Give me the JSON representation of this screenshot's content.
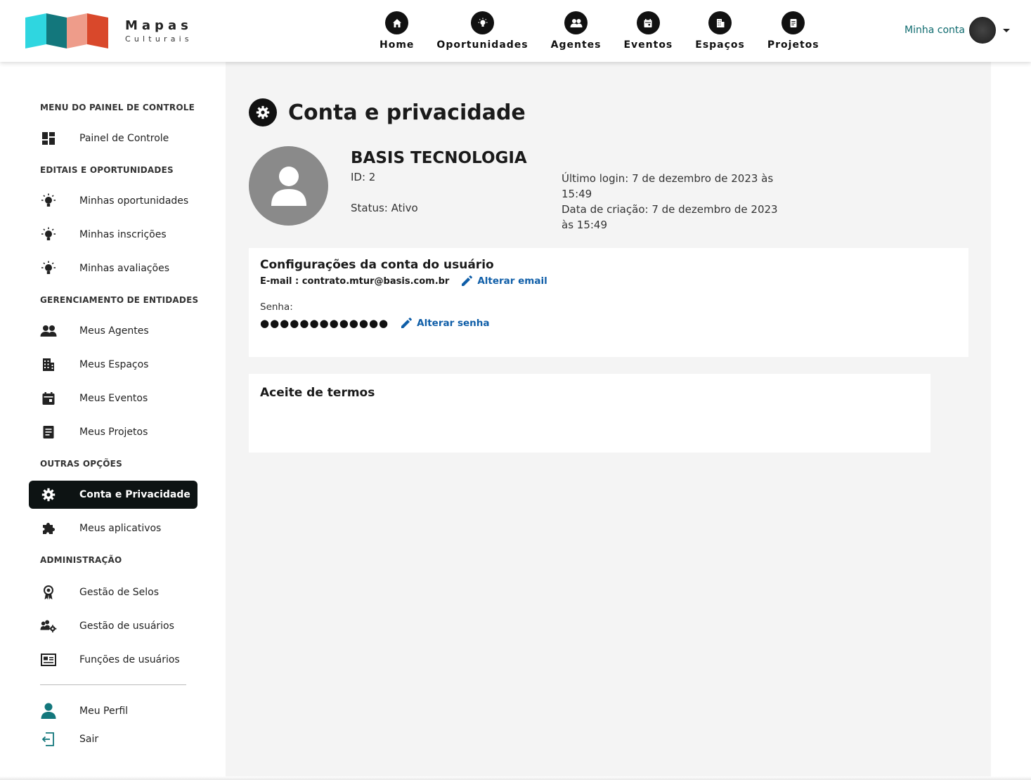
{
  "brand": {
    "title": "Mapas",
    "subtitle": "Culturais",
    "colors": [
      "#2fd6e0",
      "#13777c",
      "#ee9c8a",
      "#d9482b"
    ]
  },
  "nav": {
    "items": [
      {
        "label": "Home",
        "icon": "home-icon"
      },
      {
        "label": "Oportunidades",
        "icon": "lightbulb-icon"
      },
      {
        "label": "Agentes",
        "icon": "people-icon"
      },
      {
        "label": "Eventos",
        "icon": "calendar-icon"
      },
      {
        "label": "Espaços",
        "icon": "building-icon"
      },
      {
        "label": "Projetos",
        "icon": "document-icon"
      }
    ]
  },
  "account": {
    "label": "Minha conta"
  },
  "sidebar": {
    "headings": {
      "control": "MENU DO PAINEL DE CONTROLE",
      "editais": "EDITAIS E OPORTUNIDADES",
      "entities": "GERENCIAMENTO DE ENTIDADES",
      "other": "OUTRAS OPÇÕES",
      "admin": "ADMINISTRAÇÃO"
    },
    "items": {
      "dashboard": "Painel de Controle",
      "my_opportunities": "Minhas oportunidades",
      "my_registrations": "Minhas inscrições",
      "my_evaluations": "Minhas avaliações",
      "my_agents": "Meus Agentes",
      "my_spaces": "Meus Espaços",
      "my_events": "Meus Eventos",
      "my_projects": "Meus Projetos",
      "account_privacy": "Conta e Privacidade",
      "my_apps": "Meus aplicativos",
      "seals": "Gestão de Selos",
      "users": "Gestão de usuários",
      "roles": "Funções de usuários",
      "profile": "Meu Perfil",
      "logout": "Sair"
    },
    "active": "account_privacy"
  },
  "page": {
    "title": "Conta e privacidade",
    "profile": {
      "name": "BASIS TECNOLOGIA",
      "id": "ID: 2",
      "status": "Status: Ativo",
      "last_login": "Último login: 7 de dezembro de 2023 às 15:49",
      "created": "Data de criação: 7 de dezembro de 2023 às 15:49"
    },
    "account_settings": {
      "title": "Configurações da conta do usuário",
      "email": "E-mail : contrato.mtur@basis.com.br",
      "change_email": "Alterar email",
      "password_label": "Senha:",
      "password_mask": "●●●●●●●●●●●●●",
      "change_password": "Alterar senha"
    },
    "terms": {
      "title": "Aceite de termos"
    }
  },
  "colors": {
    "accent_teal": "#0d6a6e",
    "link_blue": "#0f5ea8",
    "active_bg": "#0d1313"
  }
}
